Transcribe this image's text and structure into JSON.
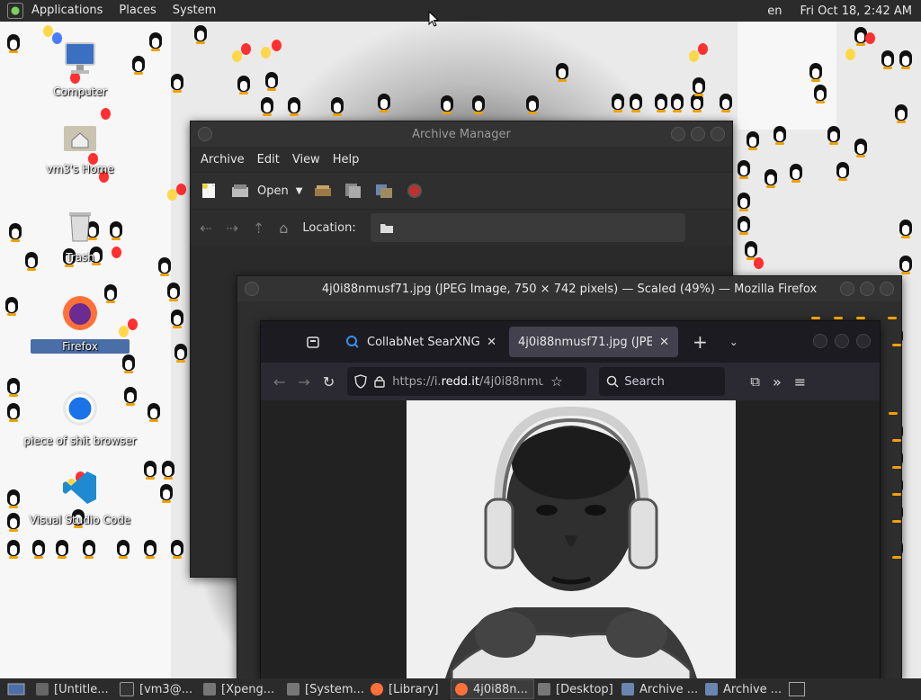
{
  "top_panel": {
    "menus": [
      "Applications",
      "Places",
      "System"
    ],
    "keyboard": "en",
    "clock": "Fri Oct 18,  2:42 AM"
  },
  "desktop_icons": [
    {
      "label": "Computer"
    },
    {
      "label": "vm3's Home"
    },
    {
      "label": "Trash"
    },
    {
      "label": "Firefox"
    },
    {
      "label": "piece of shit browser"
    },
    {
      "label": "Visual Studio Code"
    }
  ],
  "archive_manager": {
    "title": "Archive Manager",
    "menu": [
      "Archive",
      "Edit",
      "View",
      "Help"
    ],
    "open_label": "Open",
    "location_label": "Location:"
  },
  "firefox": {
    "title": "4j0i88nmusf71.jpg (JPEG Image, 750 × 742 pixels) — Scaled (49%) — Mozilla Firefox",
    "tabs": [
      {
        "label": "CollabNet SearXNG"
      },
      {
        "label": "4j0i88nmusf71.jpg (JPEG Ima"
      }
    ],
    "url_prefix": "https://i.",
    "url_domain": "redd.it",
    "url_path": "/4j0i88nmu",
    "search_placeholder": "Search"
  },
  "taskbar": [
    {
      "label": "[Untitle..."
    },
    {
      "label": "[vm3@..."
    },
    {
      "label": "[Xpeng..."
    },
    {
      "label": "[System..."
    },
    {
      "label": "[Library]"
    },
    {
      "label": "4j0i88n..."
    },
    {
      "label": "[Desktop]"
    },
    {
      "label": "Archive ..."
    },
    {
      "label": "Archive ..."
    }
  ],
  "colors": {
    "panel": "#2b2b2b",
    "window": "#2d2d2d",
    "firefox_tabbar": "#1c1b22",
    "firefox_accent": "#0060df"
  }
}
